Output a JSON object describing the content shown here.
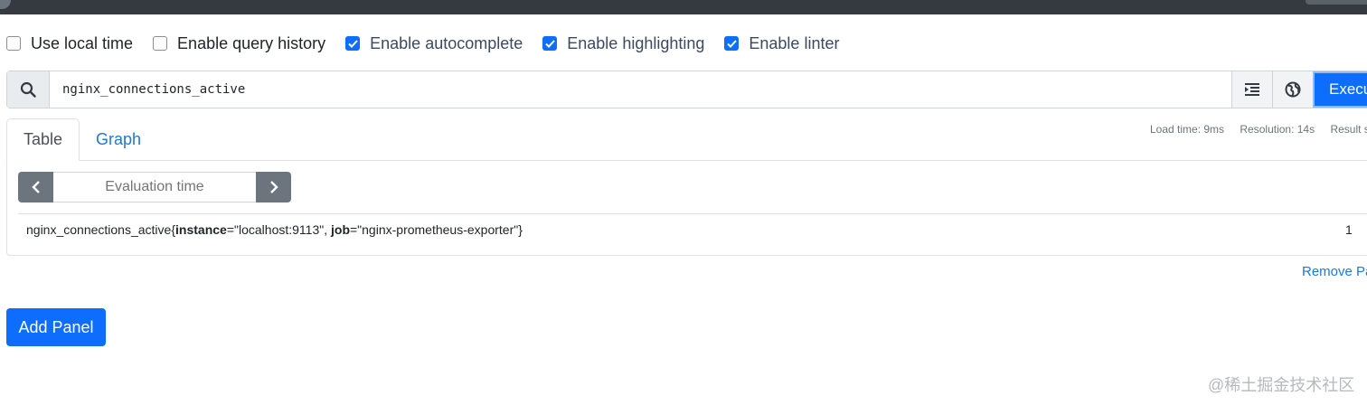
{
  "options": [
    {
      "label": "Use local time",
      "checked": false
    },
    {
      "label": "Enable query history",
      "checked": false
    },
    {
      "label": "Enable autocomplete",
      "checked": true
    },
    {
      "label": "Enable highlighting",
      "checked": true
    },
    {
      "label": "Enable linter",
      "checked": true
    }
  ],
  "query": {
    "value": "nginx_connections_active",
    "execute_label": "Execu",
    "icons": [
      "search-icon",
      "format-indent-icon",
      "globe-icon"
    ]
  },
  "panel": {
    "tabs": [
      {
        "label": "Table",
        "active": true
      },
      {
        "label": "Graph",
        "active": false
      }
    ],
    "stats": {
      "load_time": "Load time: 9ms",
      "resolution": "Resolution: 14s",
      "result_series": "Result se"
    },
    "eval_time_placeholder": "Evaluation time",
    "result": {
      "metric_name": "nginx_connections_active",
      "open_brace": "{",
      "label1_key": "instance",
      "label1_eq": "=\"localhost:9113\", ",
      "label2_key": "job",
      "label2_eq": "=\"nginx-prometheus-exporter\"",
      "close_brace": "}",
      "value": "1"
    },
    "remove_label": "Remove Pa"
  },
  "add_panel_label": "Add Panel",
  "watermark": "@稀土掘金技术社区",
  "colors": {
    "primary": "#0d6efd",
    "link": "#1f78d6",
    "topbar": "#343a40",
    "secondary": "#6c757d"
  }
}
